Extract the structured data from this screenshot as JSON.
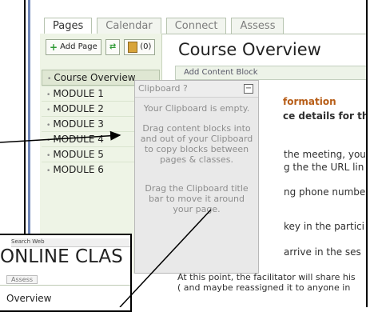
{
  "tabs": [
    "Pages",
    "Calendar",
    "Connect",
    "Assess"
  ],
  "sidebar": {
    "add_page": "Add Page",
    "clipboard_count": "(0)",
    "items": [
      "Course Overview",
      "MODULE 1",
      "MODULE 2",
      "MODULE 3",
      "MODULE 4",
      "MODULE 5",
      "MODULE 6"
    ]
  },
  "main": {
    "title": "Course Overview",
    "add_content": "Add Content Block",
    "formation": "formation",
    "details": "ce details for th",
    "line1": "the meeting, you",
    "line2": "g the the URL lin",
    "line3": "ng phone numbe",
    "line4": "key in the partici",
    "line5": "arrive in the ses",
    "line6": "At this point, the facilitator will share his",
    "line7": "( and maybe reassigned it to anyone in"
  },
  "clipboard": {
    "title": "Clipboard",
    "empty": "Your Clipboard is empty.",
    "help1": "Drag content blocks into and out of your Clipboard to copy blocks between pages & classes.",
    "help2": "Drag the Clipboard title bar to move it around your page."
  },
  "inset": {
    "search": "Search Web",
    "heading": "ONLINE CLAS",
    "tab": "Assess",
    "item": "Overview"
  }
}
